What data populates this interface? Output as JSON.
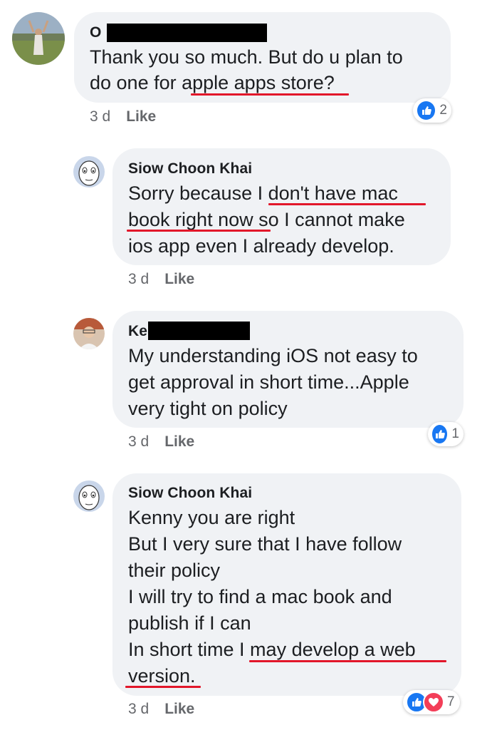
{
  "comments": [
    {
      "author": "O",
      "lines": [
        "Thank you so much. But do u plan to",
        "do one for apple apps store?"
      ],
      "time": "3 d",
      "like_label": "Like",
      "reaction_count": "2"
    },
    {
      "author": "Siow Choon Khai",
      "lines": [
        "Sorry because I don't have mac",
        "book right now so I cannot make",
        "ios app even I already develop."
      ],
      "time": "3 d",
      "like_label": "Like"
    },
    {
      "author": "Ke",
      "lines": [
        "My understanding iOS not easy to",
        "get approval in short time...Apple",
        "very tight on policy"
      ],
      "time": "3 d",
      "like_label": "Like",
      "reaction_count": "1"
    },
    {
      "author": "Siow Choon Khai",
      "lines": [
        "Kenny you are right",
        "But I very sure that I have follow",
        "their policy",
        "I will try to find a mac book and",
        "publish if I can",
        "In short time I may develop a web",
        "version."
      ],
      "time": "3 d",
      "like_label": "Like",
      "reaction_count": "7"
    }
  ],
  "icons": {
    "like_reaction": "thumbs-up-icon",
    "love_reaction": "heart-icon"
  },
  "colors": {
    "bubble": "#f0f2f5",
    "annotation_underline": "#e2172a",
    "like_blue": "#1877f2",
    "love_red": "#f33e58"
  }
}
